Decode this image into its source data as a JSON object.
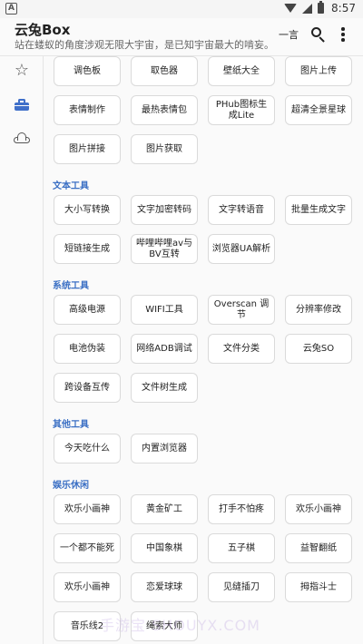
{
  "status_bar": {
    "app_letter": "A",
    "time": "8:57"
  },
  "app_bar": {
    "title": "云兔Box",
    "subtitle": "站在蝼蚁的角度涉观无限大宇宙，是已知宇宙最大的啃妄。",
    "yiyan_label": "一言",
    "search_icon": "search-icon",
    "more_icon": "more-vert-icon"
  },
  "sidebar": {
    "items": [
      {
        "icon": "star-icon",
        "selected": false
      },
      {
        "icon": "toolbox-icon",
        "selected": true
      },
      {
        "icon": "cloud-icon",
        "selected": false
      }
    ]
  },
  "accent_color": "#3a6fc4",
  "sections": [
    {
      "title": "",
      "items": [
        "调色板",
        "取色器",
        "壁纸大全",
        "图片上传",
        "表情制作",
        "最热表情包",
        "PHub图标生成Lite",
        "超清全景星球",
        "图片拼接",
        "图片获取"
      ]
    },
    {
      "title": "文本工具",
      "items": [
        "大小写转换",
        "文字加密转码",
        "文字转语音",
        "批量生成文字",
        "短链接生成",
        "哔哩哔哩av与BV互转",
        "浏览器UA解析"
      ]
    },
    {
      "title": "系统工具",
      "items": [
        "高级电源",
        "WIFI工具",
        "Overscan 调节",
        "分辨率修改",
        "电池伪装",
        "网络ADB调试",
        "文件分类",
        "云兔SO",
        "跨设备互传",
        "文件树生成"
      ]
    },
    {
      "title": "其他工具",
      "items": [
        "今天吃什么",
        "内置浏览器"
      ]
    },
    {
      "title": "娱乐休闲",
      "items": [
        "欢乐小画神",
        "黄金矿工",
        "打手不怕疼",
        "欢乐小画神",
        "一个都不能死",
        "中国象棋",
        "五子棋",
        "益智翻纸",
        "欢乐小画神",
        "恋爱球球",
        "见缝插刀",
        "拇指斗士",
        "音乐线2",
        "绳索大师"
      ]
    }
  ],
  "watermark": "手游宝 SHOUYX.COM"
}
